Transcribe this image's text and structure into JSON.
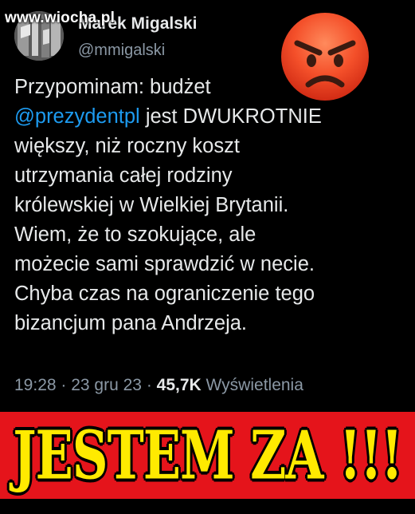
{
  "watermark": "www.wiocha.pl",
  "author": {
    "display_name": "Marek Migalski",
    "handle": "@mmigalski"
  },
  "emoji": "angry-face-icon",
  "tweet": {
    "lines": [
      {
        "pre": "Przypominam: budżet",
        "mention": "",
        "post": ""
      },
      {
        "pre": "",
        "mention": "@prezydentpl",
        "post": " jest DWUKROTNIE"
      },
      {
        "pre": "większy, niż roczny koszt",
        "mention": "",
        "post": ""
      },
      {
        "pre": "utrzymania całej rodziny",
        "mention": "",
        "post": ""
      },
      {
        "pre": "królewskiej w Wielkiej Brytanii.",
        "mention": "",
        "post": ""
      },
      {
        "pre": "Wiem, że to szokujące, ale",
        "mention": "",
        "post": ""
      },
      {
        "pre": "możecie sami sprawdzić w necie.",
        "mention": "",
        "post": ""
      },
      {
        "pre": "Chyba czas na ograniczenie tego",
        "mention": "",
        "post": ""
      },
      {
        "pre": "bizancjum pana Andrzeja.",
        "mention": "",
        "post": ""
      }
    ]
  },
  "meta": {
    "time": "19:28",
    "date": "23 gru 23",
    "views_count": "45,7K",
    "views_label": "Wyświetlenia",
    "separator": " · "
  },
  "banner": {
    "text": "JESTEM  ZA !!!"
  },
  "colors": {
    "mention": "#1d9bf0",
    "banner_bg": "#e5141b",
    "banner_text": "#ffea00"
  }
}
